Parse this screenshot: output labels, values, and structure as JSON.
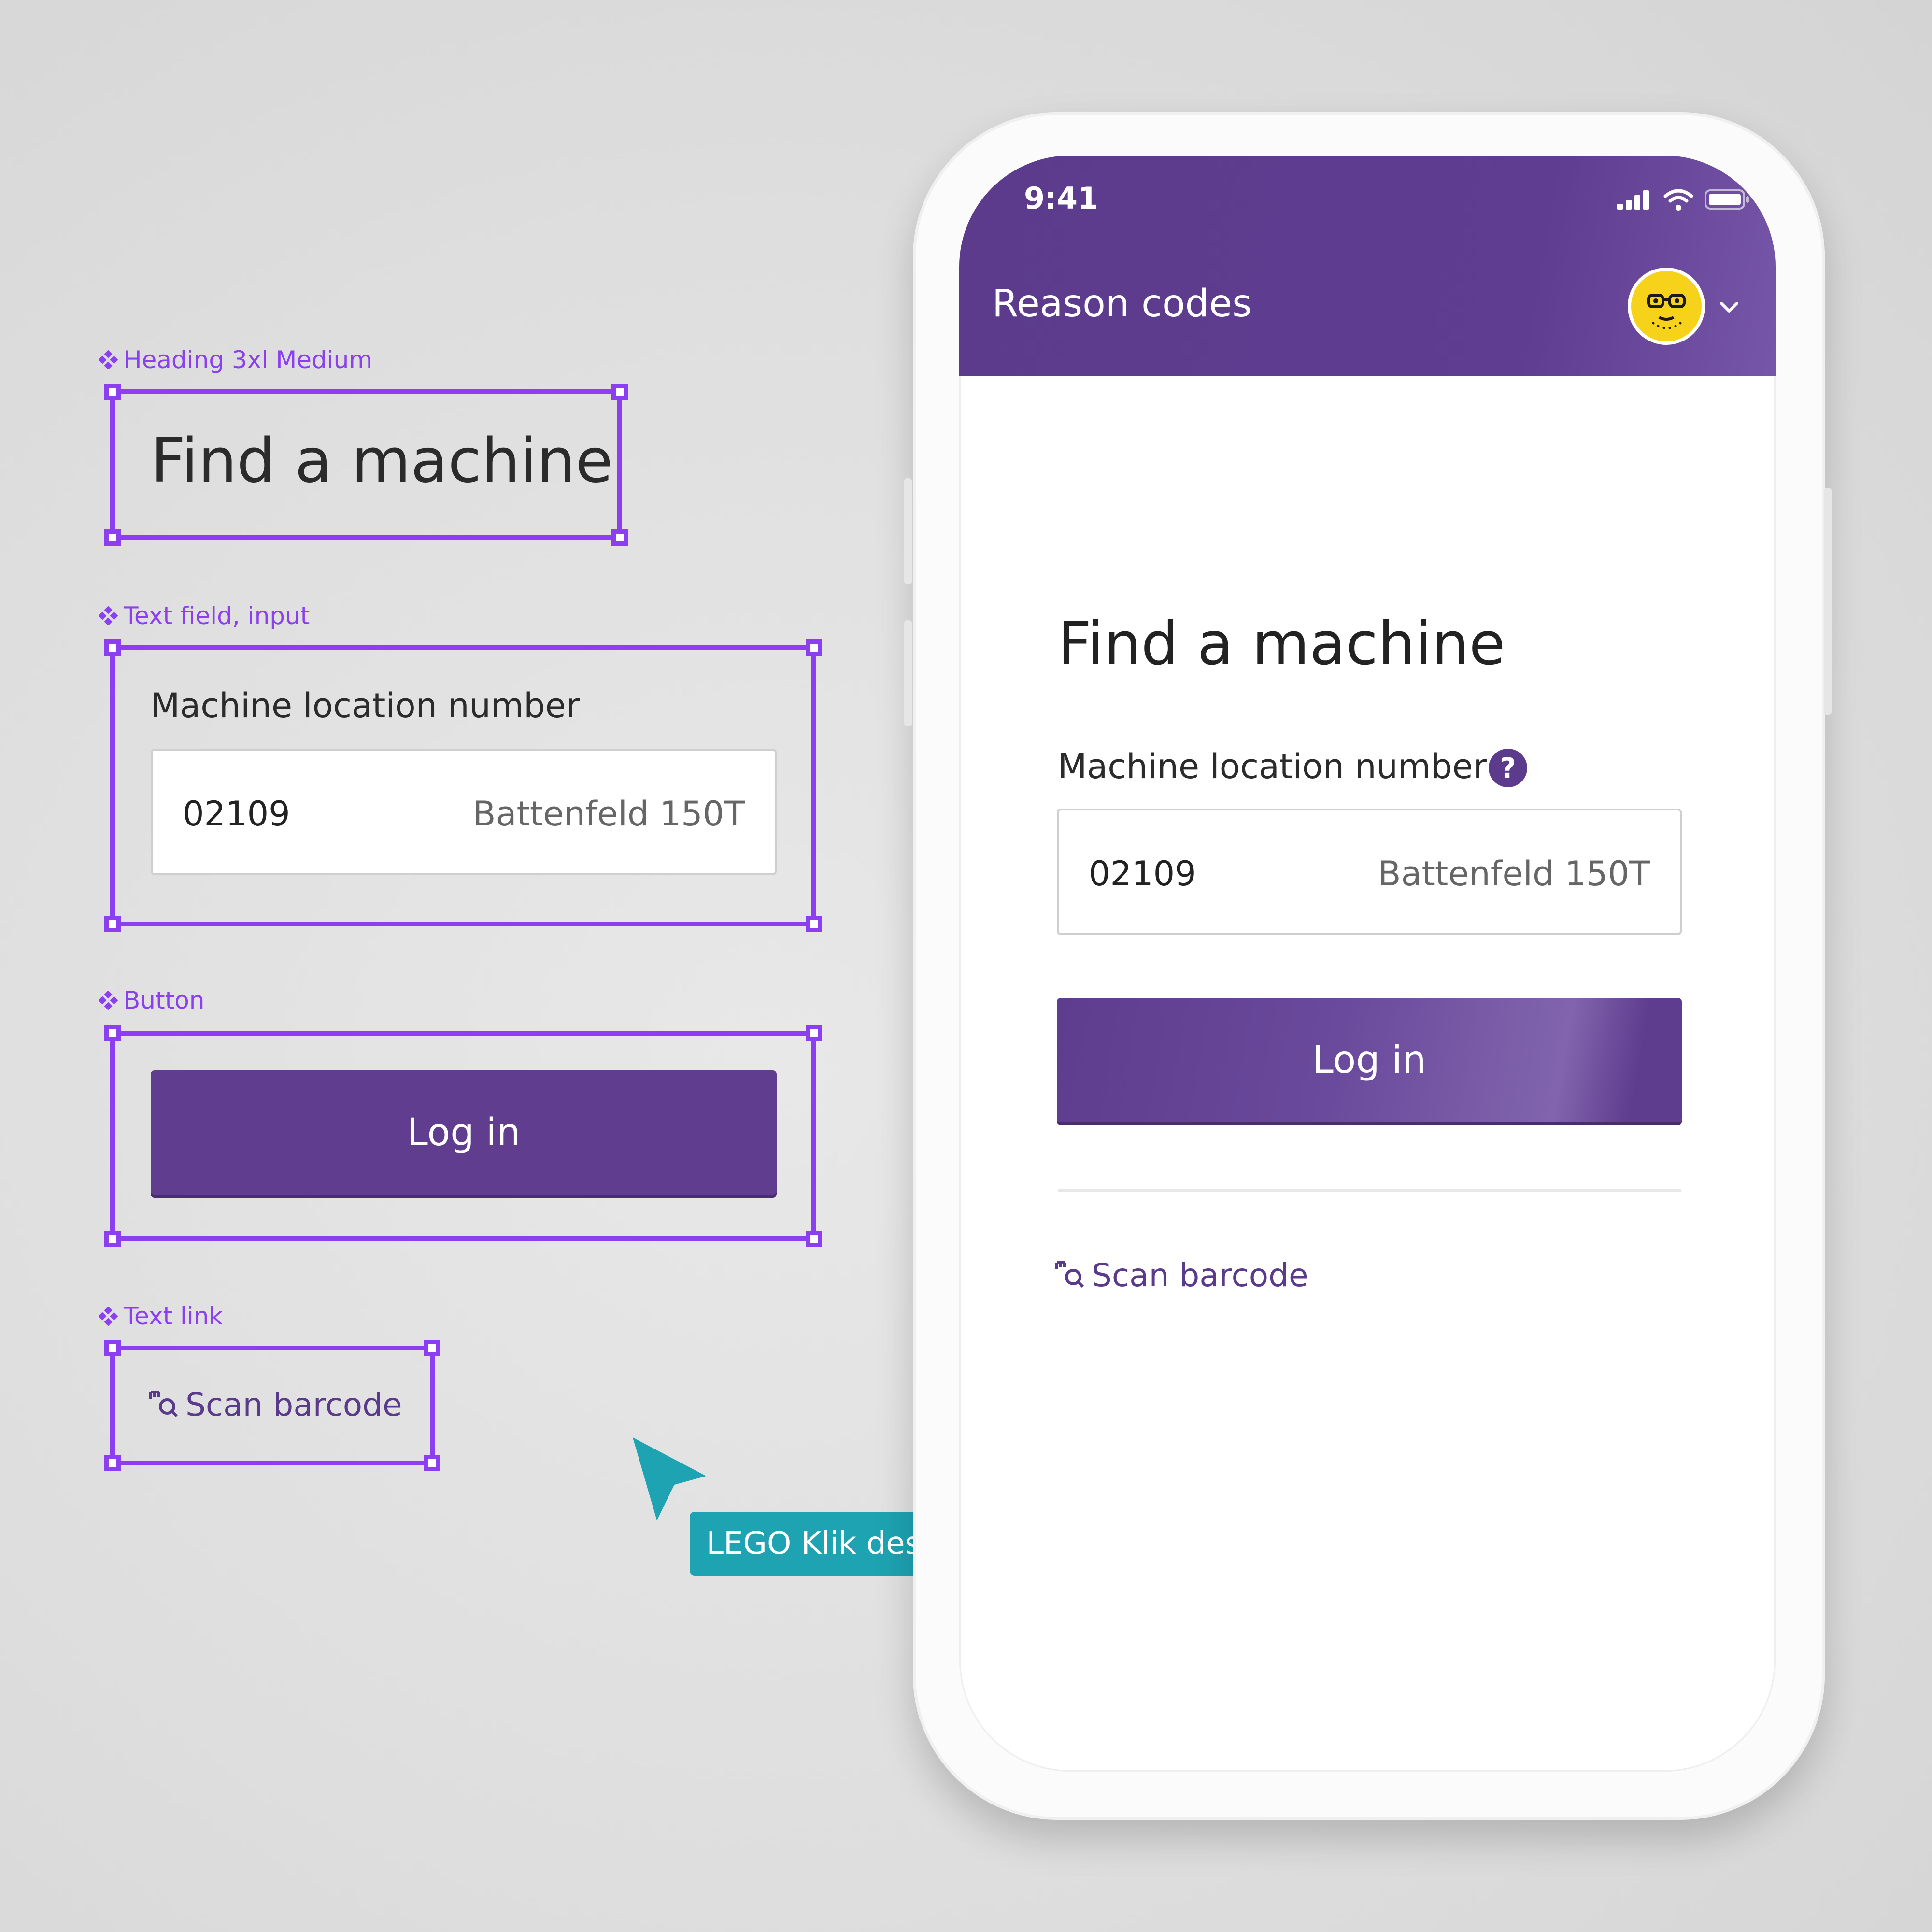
{
  "spec": {
    "heading_label": "Heading 3xl Medium",
    "heading_text": "Find a machine",
    "textfield_label": "Text field, input",
    "field_label": "Machine location number",
    "field_value": "02109",
    "field_hint": "Battenfeld 150T",
    "button_label": "Button",
    "button_text": "Log in",
    "textlink_label": "Text link",
    "textlink_text": "Scan barcode"
  },
  "designer_tag": "LEGO Klik designer",
  "phone": {
    "status_time": "9:41",
    "app_title": "Reason codes",
    "heading": "Find a machine",
    "field_label": "Machine location number",
    "help_glyph": "?",
    "field_value": "02109",
    "field_hint": "Battenfeld 150T",
    "login_button": "Log in",
    "scan_link": "Scan barcode"
  },
  "colors": {
    "annotation_purple": "#8b3ff0",
    "brand_purple": "#5c3b8c",
    "designer_teal": "#1ea3b2",
    "avatar_yellow": "#f6d21a"
  },
  "icons": [
    "component-icon",
    "scan-barcode-icon",
    "cursor-arrow-icon",
    "signal-icon",
    "wifi-icon",
    "battery-icon",
    "avatar-icon",
    "chevron-down-icon",
    "help-icon"
  ]
}
